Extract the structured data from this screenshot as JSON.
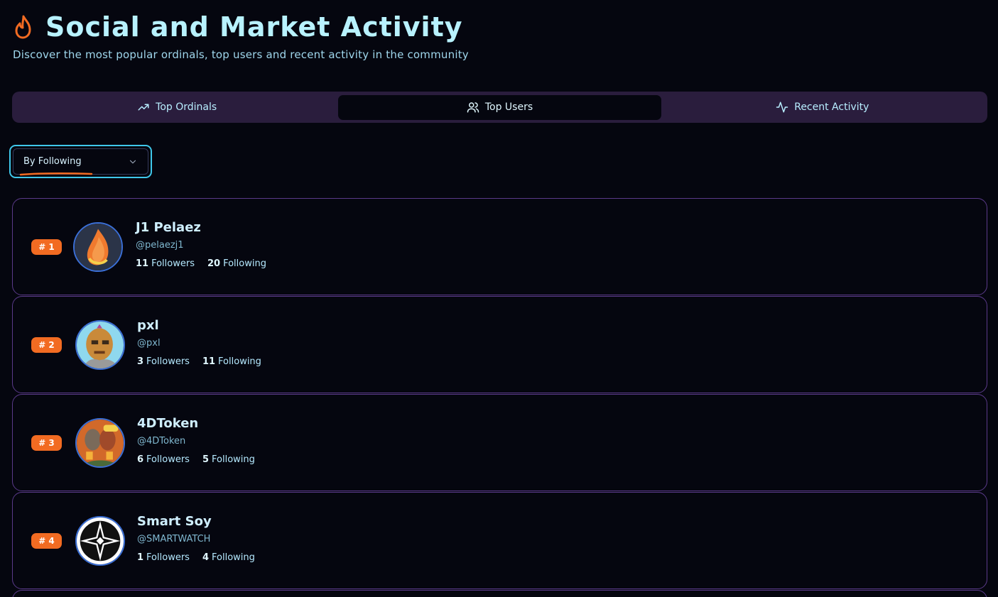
{
  "header": {
    "title": "Social and Market Activity",
    "subtitle": "Discover the most popular ordinals, top users and recent activity in the community",
    "icon": "flame-icon",
    "accent": "#f26b22"
  },
  "tabs": [
    {
      "label": "Top Ordinals",
      "icon": "trending-up-icon",
      "active": false
    },
    {
      "label": "Top Users",
      "icon": "users-icon",
      "active": true
    },
    {
      "label": "Recent Activity",
      "icon": "activity-icon",
      "active": false
    }
  ],
  "sort_select": {
    "value": "By Following",
    "icon": "chevron-down-icon"
  },
  "users": [
    {
      "rank": "# 1",
      "name": "J1 Pelaez",
      "handle": "@pelaezj1",
      "followers": "11",
      "followers_label": "Followers",
      "following": "20",
      "following_label": "Following",
      "avatar": "flame-avatar"
    },
    {
      "rank": "# 2",
      "name": "pxl",
      "handle": "@pxl",
      "followers": "3",
      "followers_label": "Followers",
      "following": "11",
      "following_label": "Following",
      "avatar": "pixel-face-avatar"
    },
    {
      "rank": "# 3",
      "name": "4DToken",
      "handle": "@4DToken",
      "followers": "6",
      "followers_label": "Followers",
      "following": "5",
      "following_label": "Following",
      "avatar": "cartoon-cheers-avatar"
    },
    {
      "rank": "# 4",
      "name": "Smart Soy",
      "handle": "@SMARTWATCH",
      "followers": "1",
      "followers_label": "Followers",
      "following": "4",
      "following_label": "Following",
      "avatar": "compass-star-avatar"
    }
  ],
  "colors": {
    "background": "#05060f",
    "tab_bar": "#2a1d3d",
    "card_border": "#5a3a8a",
    "badge": "#f26b22",
    "select_focus": "#3fc7ea",
    "title": "#b8f2ff"
  }
}
